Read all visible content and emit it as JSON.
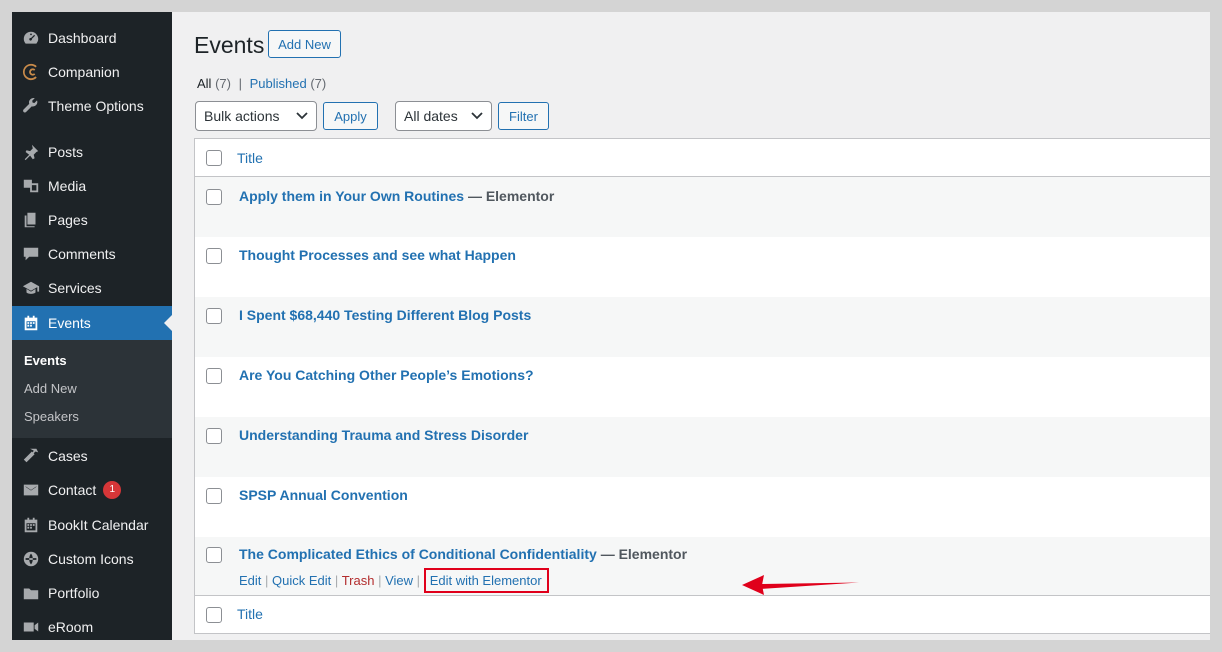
{
  "sidebar": {
    "items": [
      {
        "label": "Dashboard",
        "icon": "dashboard-icon"
      },
      {
        "label": "Companion",
        "icon": "companion-logo-icon"
      },
      {
        "label": "Theme Options",
        "icon": "wrench-icon"
      },
      {
        "label": "Posts",
        "icon": "pushpin-icon"
      },
      {
        "label": "Media",
        "icon": "media-icon"
      },
      {
        "label": "Pages",
        "icon": "pages-icon"
      },
      {
        "label": "Comments",
        "icon": "comment-icon"
      },
      {
        "label": "Services",
        "icon": "graduation-cap-icon"
      },
      {
        "label": "Events",
        "icon": "calendar-icon"
      },
      {
        "label": "Cases",
        "icon": "hammer-icon"
      },
      {
        "label": "Contact",
        "icon": "mail-icon",
        "badge": "1"
      },
      {
        "label": "BookIt Calendar",
        "icon": "calendar-icon"
      },
      {
        "label": "Custom Icons",
        "icon": "globe-icon"
      },
      {
        "label": "Portfolio",
        "icon": "folder-icon"
      },
      {
        "label": "eRoom",
        "icon": "video-icon"
      }
    ],
    "submenu": [
      "Events",
      "Add New",
      "Speakers"
    ]
  },
  "header": {
    "title": "Events",
    "add_new": "Add New"
  },
  "filters": {
    "all_label": "All",
    "all_count": "(7)",
    "separator": "|",
    "published_label": "Published",
    "published_count": "(7)",
    "bulk_actions": "Bulk actions",
    "apply": "Apply",
    "all_dates": "All dates",
    "filter": "Filter"
  },
  "table": {
    "column_title": "Title",
    "rows": [
      {
        "title": "Apply them in Your Own Routines",
        "state": "— Elementor"
      },
      {
        "title": "Thought Processes and see what Happen",
        "state": ""
      },
      {
        "title": "I Spent $68,440 Testing Different Blog Posts",
        "state": ""
      },
      {
        "title": "Are You Catching Other People’s Emotions?",
        "state": ""
      },
      {
        "title": "Understanding Trauma and Stress Disorder",
        "state": ""
      },
      {
        "title": "SPSP Annual Convention",
        "state": ""
      },
      {
        "title": "The Complicated Ethics of Conditional Confidentiality",
        "state": "— Elementor"
      }
    ],
    "row_actions": {
      "edit": "Edit",
      "quick_edit": "Quick Edit",
      "trash": "Trash",
      "view": "View",
      "edit_with_elementor": "Edit with Elementor",
      "sep": "|"
    }
  },
  "colors": {
    "sidebar_bg": "#1d2327",
    "accent": "#2271b1",
    "highlight_annotation": "#e0001b"
  }
}
